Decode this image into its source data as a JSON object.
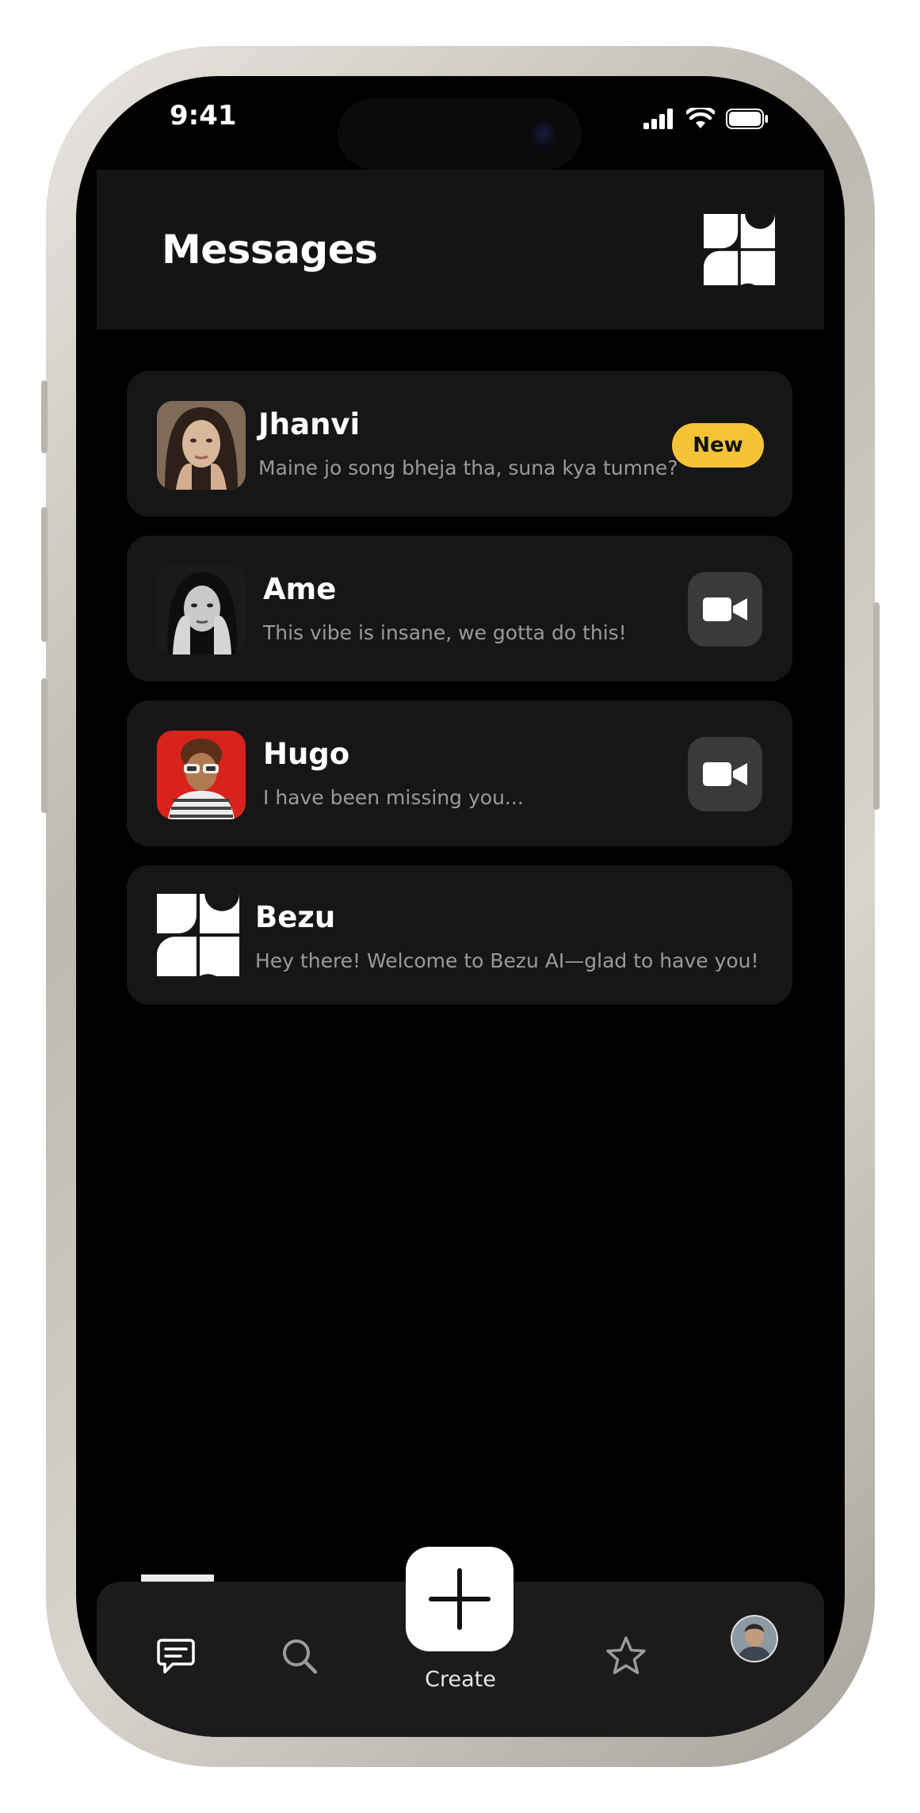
{
  "status_bar": {
    "time": "9:41"
  },
  "header": {
    "title": "Messages",
    "logo_icon": "bezu-logo-icon"
  },
  "conversations": [
    {
      "name": "Jhanvi",
      "preview": "Maine jo song bheja tha, suna kya tumne?",
      "badge": "New"
    },
    {
      "name": "Ame",
      "preview": "This vibe is insane, we gotta do this!",
      "action_icon": "video-camera-icon"
    },
    {
      "name": "Hugo",
      "preview": "I have been missing you...",
      "action_icon": "video-camera-icon"
    },
    {
      "name": "Bezu",
      "preview": "Hey there! Welcome to Bezu AI—glad to have you!"
    }
  ],
  "tab_bar": {
    "items": [
      "messages-icon",
      "search-icon",
      "create-plus-icon",
      "star-icon",
      "profile-avatar"
    ],
    "create_label": "Create",
    "active": "messages"
  },
  "colors": {
    "badge": "#f5c338",
    "card": "#161616",
    "background": "#000000"
  }
}
